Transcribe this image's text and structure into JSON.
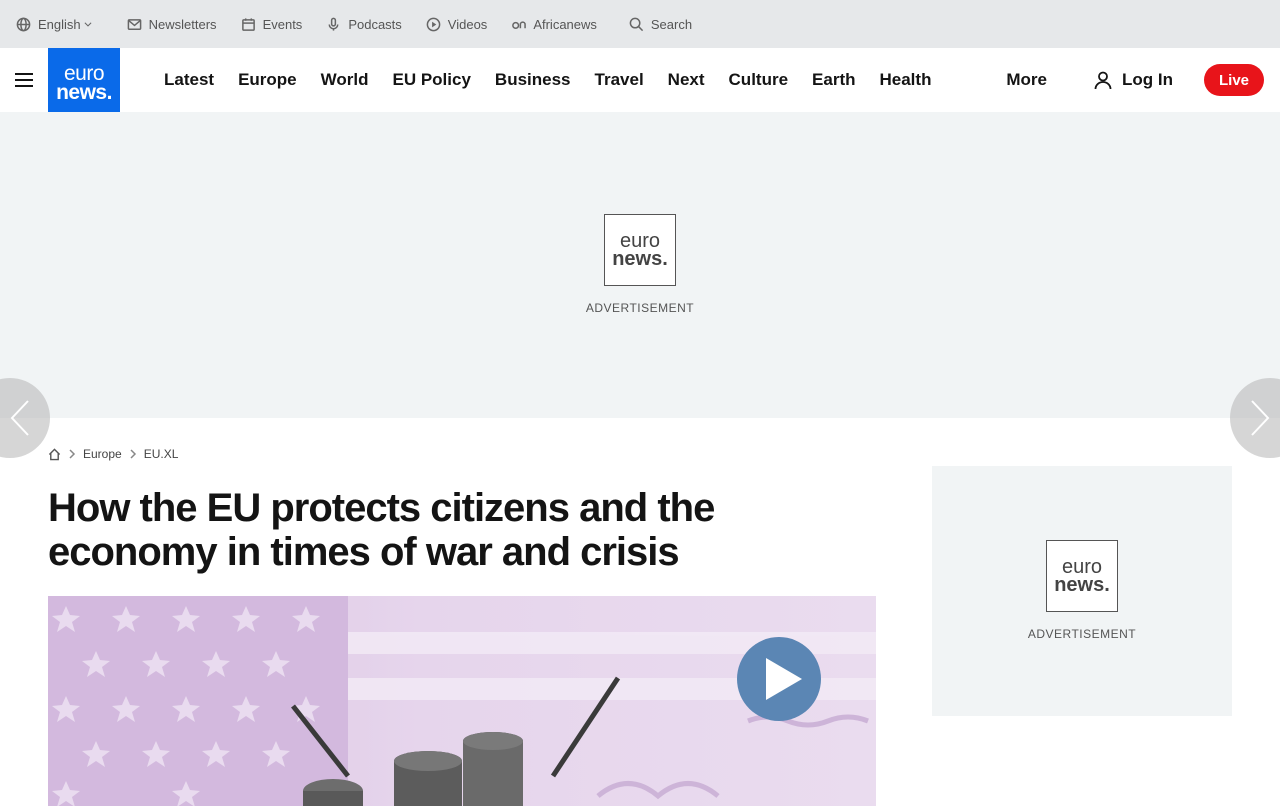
{
  "topbar": {
    "language": "English",
    "items": [
      {
        "label": "Newsletters",
        "icon": "envelope-icon"
      },
      {
        "label": "Events",
        "icon": "calendar-icon"
      },
      {
        "label": "Podcasts",
        "icon": "microphone-icon"
      },
      {
        "label": "Videos",
        "icon": "play-circle-icon"
      },
      {
        "label": "Africanews",
        "icon": "africanews-icon"
      }
    ],
    "search_label": "Search"
  },
  "logo": {
    "line1": "euro",
    "line2": "news."
  },
  "nav": {
    "links": [
      "Latest",
      "Europe",
      "World",
      "EU Policy",
      "Business",
      "Travel",
      "Next",
      "Culture",
      "Earth",
      "Health"
    ],
    "more": "More",
    "login": "Log In",
    "live": "Live"
  },
  "ads": {
    "banner_label": "ADVERTISEMENT",
    "side_label": "ADVERTISEMENT",
    "logo_line1": "euro",
    "logo_line2": "news."
  },
  "breadcrumb": [
    "Europe",
    "EU.XL"
  ],
  "article": {
    "headline": "How the EU protects citizens and the economy in times of war and crisis"
  },
  "colors": {
    "brand": "#0a6ae9",
    "live": "#e8141a",
    "topbar_bg": "#e6e8ea",
    "ad_bg": "#f1f4f5",
    "play": "#5b86b4"
  }
}
